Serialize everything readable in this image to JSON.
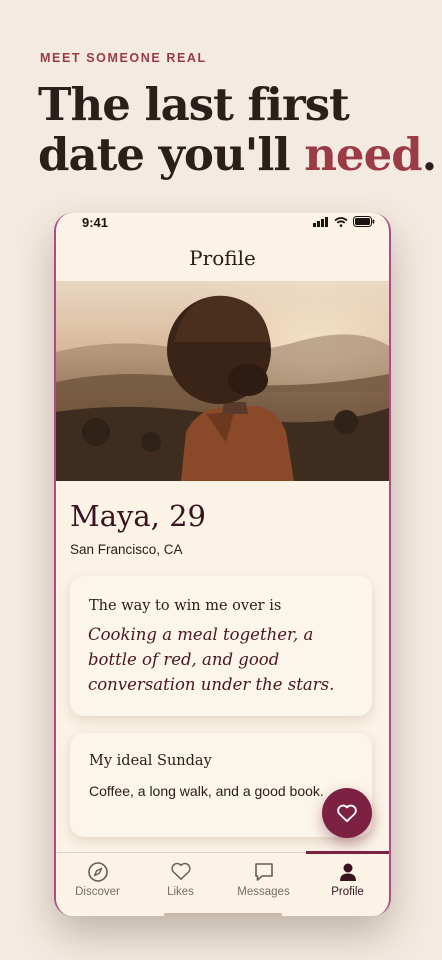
{
  "marketing": {
    "eyebrow": "MEET SOMEONE REAL",
    "headline_line1": "The last first",
    "headline_line2_start": "date you'll ",
    "headline_accent": "need",
    "headline_end": "."
  },
  "status_bar": {
    "time": "9:41"
  },
  "app": {
    "title": "Profile"
  },
  "profile": {
    "name": "Maya, 29",
    "location": "San Francisco, CA"
  },
  "prompts": [
    {
      "question": "The way to win me over is",
      "answer": "Cooking a meal together, a bottle of red, and good conversation under the stars."
    },
    {
      "question": "My ideal Sunday",
      "answer": "Coffee, a long walk, and a good book."
    }
  ],
  "tabs": [
    {
      "label": "Discover",
      "icon": "compass-icon"
    },
    {
      "label": "Likes",
      "icon": "heart-icon"
    },
    {
      "label": "Messages",
      "icon": "chat-icon"
    },
    {
      "label": "Profile",
      "icon": "person-icon",
      "active": true
    }
  ],
  "colors": {
    "accent": "#9a3b45",
    "primary": "#7d2142",
    "background": "#f3ebe1",
    "card": "#fcf5ea"
  }
}
